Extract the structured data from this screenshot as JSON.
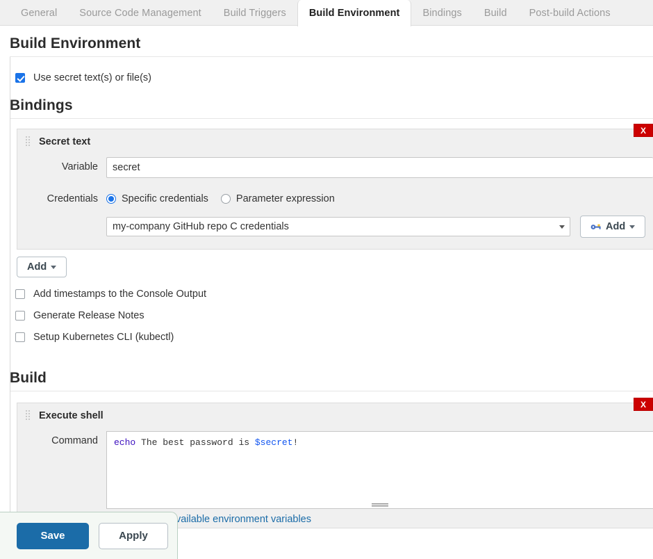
{
  "tabs": [
    {
      "label": "General",
      "active": false
    },
    {
      "label": "Source Code Management",
      "active": false
    },
    {
      "label": "Build Triggers",
      "active": false
    },
    {
      "label": "Build Environment",
      "active": true
    },
    {
      "label": "Bindings",
      "active": false
    },
    {
      "label": "Build",
      "active": false
    },
    {
      "label": "Post-build Actions",
      "active": false
    }
  ],
  "build_environment": {
    "title": "Build Environment",
    "use_secrets": {
      "label": "Use secret text(s) or file(s)",
      "checked": true
    },
    "bindings": {
      "title": "Bindings",
      "binding": {
        "title": "Secret text",
        "delete_label": "X",
        "variable": {
          "label": "Variable",
          "value": "secret",
          "placeholder": ""
        },
        "credentials": {
          "label": "Credentials",
          "radio_specific": "Specific credentials",
          "radio_parameter": "Parameter expression",
          "selected_radio": "specific",
          "selected_option": "my-company GitHub repo C credentials",
          "options": [
            "my-company GitHub repo C credentials"
          ],
          "add_button": {
            "label": "Add",
            "icon": "key-icon"
          }
        }
      },
      "add_button": {
        "label": "Add"
      }
    },
    "options": [
      {
        "label": "Add timestamps to the Console Output",
        "checked": false
      },
      {
        "label": "Generate Release Notes",
        "checked": false
      },
      {
        "label": "Setup Kubernetes CLI (kubectl)",
        "checked": false
      }
    ]
  },
  "build": {
    "title": "Build",
    "step": {
      "title": "Execute shell",
      "delete_label": "X",
      "command": {
        "label": "Command",
        "code_prefix": "echo",
        "code_middle": " The best password is ",
        "code_variable": "$secret",
        "code_suffix": "!"
      },
      "help_link": "See the list of available environment variables"
    }
  },
  "footer": {
    "save_label": "Save",
    "apply_label": "Apply"
  },
  "colors": {
    "accent_blue": "#1a73e8",
    "save_blue": "#1b6ca8",
    "delete_red": "#cc0000",
    "link_blue": "#1b6ca8",
    "keyword_purple": "#3b0fbf",
    "variable_blue": "#1155f0"
  }
}
